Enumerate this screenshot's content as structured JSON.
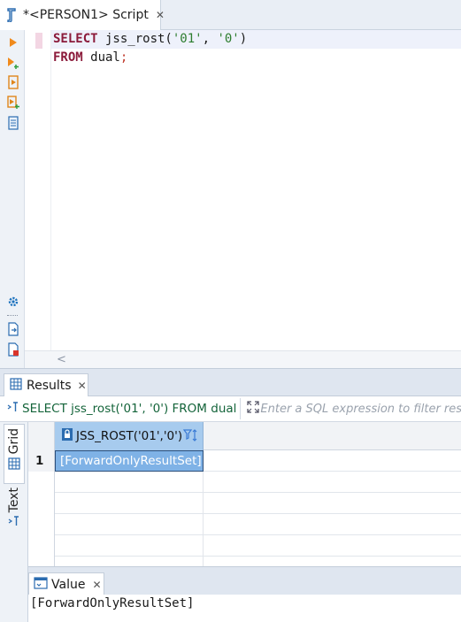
{
  "editor": {
    "tab_title": "*<PERSON1> Script",
    "code_lines": [
      {
        "kw": "SELECT",
        "func": " jss_rost(",
        "arg1": "'01'",
        "sep": ", ",
        "arg2": "'0'",
        "close": ")"
      },
      {
        "kw": "FROM",
        "rest": " dual",
        "semi": ";"
      }
    ],
    "scroll_left_arrow": "<"
  },
  "toolbar_icons": [
    "execute-statement-icon",
    "execute-statement-new-tab-icon",
    "execute-script-icon",
    "execute-script-new-tab-icon",
    "explain-plan-icon",
    "settings-icon",
    "export-icon",
    "close-icon"
  ],
  "results": {
    "tab_label": "Results",
    "query_text": "SELECT jss_rost('01', '0') FROM dual",
    "filter_placeholder": "Enter a SQL expression to filter results",
    "side_tabs": {
      "grid": "Grid",
      "text": "Text"
    },
    "columns": [
      "JSS_ROST('01','0')"
    ],
    "rows": [
      {
        "num": "1",
        "value": "[ForwardOnlyResultSet]"
      }
    ]
  },
  "value_panel": {
    "tab_label": "Value",
    "content": "[ForwardOnlyResultSet]"
  },
  "colors": {
    "keyword": "#8b1a3a",
    "string": "#2d7d2f",
    "selected_cell": "#7fb2e6",
    "column_header": "#a7cbee",
    "query_text": "#14643a"
  }
}
